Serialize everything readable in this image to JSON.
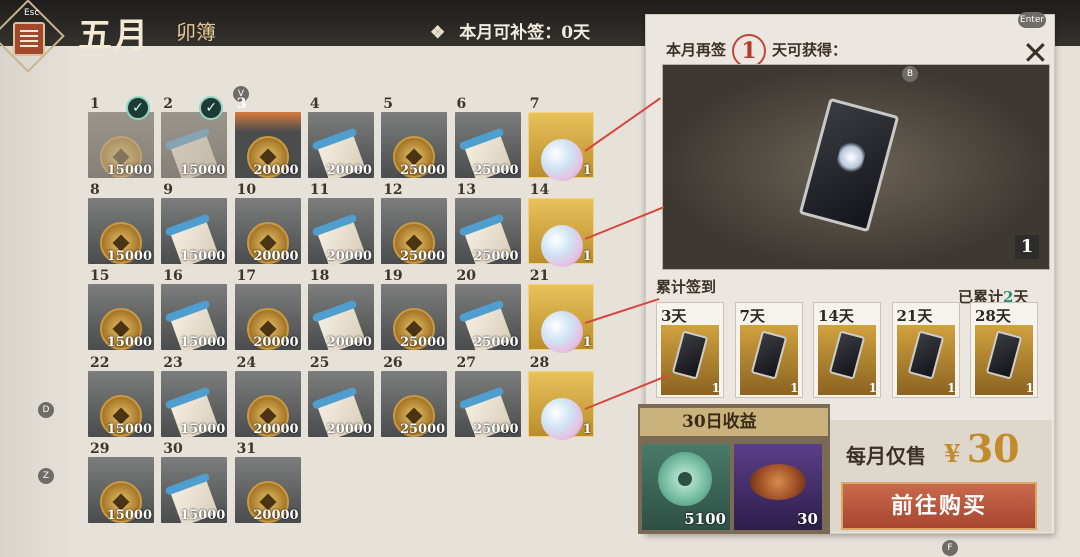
{
  "header": {
    "esc_label": "Esc",
    "title": "五月",
    "subtitle": "卯簿",
    "makeup_icon": "❖",
    "makeup_text": "本月可补签：0天"
  },
  "keys": {
    "v": "V",
    "d": "D",
    "z": "Z",
    "enter": "Enter",
    "b": "B",
    "f": "F"
  },
  "days": [
    {
      "n": "1",
      "amt": "15000",
      "item": "coin",
      "done": true
    },
    {
      "n": "2",
      "amt": "15000",
      "item": "scroll",
      "done": true
    },
    {
      "n": "3",
      "amt": "20000",
      "item": "coin",
      "today": true
    },
    {
      "n": "4",
      "amt": "20000",
      "item": "scroll"
    },
    {
      "n": "5",
      "amt": "25000",
      "item": "coin"
    },
    {
      "n": "6",
      "amt": "25000",
      "item": "scroll"
    },
    {
      "n": "7",
      "amt": "1",
      "item": "orb"
    },
    {
      "n": "8",
      "amt": "15000",
      "item": "coin"
    },
    {
      "n": "9",
      "amt": "15000",
      "item": "scroll"
    },
    {
      "n": "10",
      "amt": "20000",
      "item": "coin"
    },
    {
      "n": "11",
      "amt": "20000",
      "item": "scroll"
    },
    {
      "n": "12",
      "amt": "25000",
      "item": "coin"
    },
    {
      "n": "13",
      "amt": "25000",
      "item": "scroll"
    },
    {
      "n": "14",
      "amt": "1",
      "item": "orb"
    },
    {
      "n": "15",
      "amt": "15000",
      "item": "coin"
    },
    {
      "n": "16",
      "amt": "15000",
      "item": "scroll"
    },
    {
      "n": "17",
      "amt": "20000",
      "item": "coin"
    },
    {
      "n": "18",
      "amt": "20000",
      "item": "scroll"
    },
    {
      "n": "19",
      "amt": "25000",
      "item": "coin"
    },
    {
      "n": "20",
      "amt": "25000",
      "item": "scroll"
    },
    {
      "n": "21",
      "amt": "1",
      "item": "orb"
    },
    {
      "n": "22",
      "amt": "15000",
      "item": "coin"
    },
    {
      "n": "23",
      "amt": "15000",
      "item": "scroll"
    },
    {
      "n": "24",
      "amt": "20000",
      "item": "coin"
    },
    {
      "n": "25",
      "amt": "20000",
      "item": "scroll"
    },
    {
      "n": "26",
      "amt": "25000",
      "item": "coin"
    },
    {
      "n": "27",
      "amt": "25000",
      "item": "scroll"
    },
    {
      "n": "28",
      "amt": "1",
      "item": "orb"
    },
    {
      "n": "29",
      "amt": "15000",
      "item": "coin"
    },
    {
      "n": "30",
      "amt": "15000",
      "item": "scroll"
    },
    {
      "n": "31",
      "amt": "20000",
      "item": "coin"
    }
  ],
  "panel": {
    "reward_prefix": "本月再签",
    "reward_days": "1",
    "reward_suffix": "天可获得：",
    "reward_count": "1",
    "close_icon": "✕",
    "cumulative_label": "累计签到",
    "cumulative_done_prefix": "已累计",
    "cumulative_done_days": "2",
    "cumulative_done_suffix": "天",
    "milestones": [
      {
        "day": "3天",
        "count": "1"
      },
      {
        "day": "7天",
        "count": "1"
      },
      {
        "day": "14天",
        "count": "1"
      },
      {
        "day": "21天",
        "count": "1"
      },
      {
        "day": "28天",
        "count": "1"
      }
    ],
    "income_title": "30日收益",
    "income_items": [
      {
        "amount": "5100",
        "icon": "jade-disc-icon"
      },
      {
        "amount": "30",
        "icon": "food-plate-icon"
      }
    ],
    "price_label": "每月仅售",
    "currency": "¥",
    "price": "30",
    "buy_label": "前往购买"
  },
  "colors": {
    "accent_red": "#d8453c",
    "gold": "#c38a2e",
    "buy_button": "#b8503a",
    "done_teal": "#2f8f73"
  }
}
